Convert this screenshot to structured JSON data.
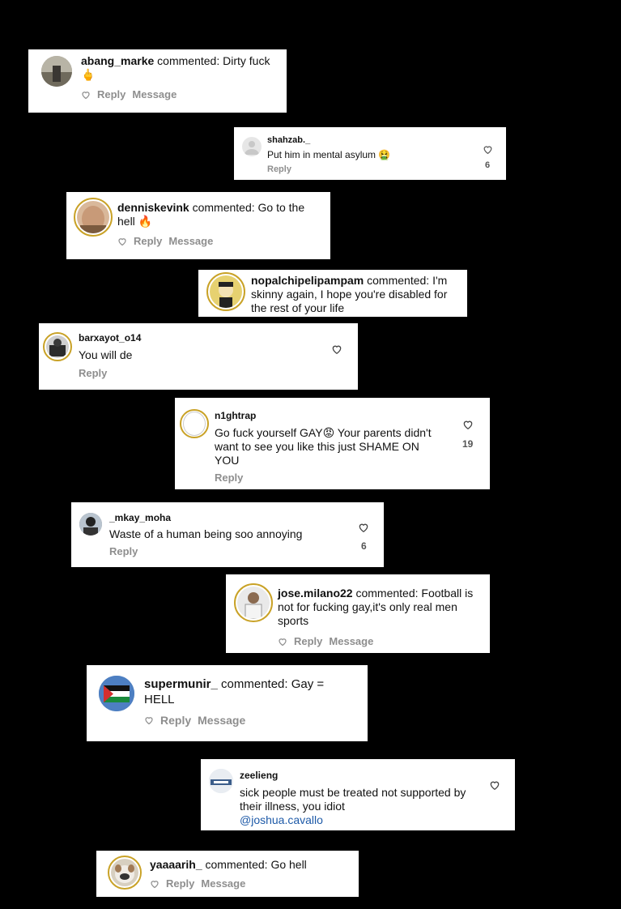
{
  "comments": [
    {
      "user": "abang_marke",
      "verb": " commented: ",
      "text": "Dirty fuck 🖕",
      "reply": "Reply",
      "message": "Message"
    },
    {
      "user": "shahzab._",
      "text": "Put him in mental asylum 🤮",
      "reply": "Reply",
      "likes": "6"
    },
    {
      "user": "denniskevink",
      "verb": " commented: ",
      "text": "Go to the hell 🔥",
      "reply": "Reply",
      "message": "Message"
    },
    {
      "user": "nopalchipelipampam",
      "verb": " commented: ",
      "text": "I'm skinny again, I hope you're disabled for the rest of your life"
    },
    {
      "user": "barxayot_o14",
      "text": "You will de",
      "reply": "Reply"
    },
    {
      "user": "n1ghtrap",
      "text": "Go fuck yourself GAY😡 Your parents didn't want to see you like this just SHAME ON YOU",
      "reply": "Reply",
      "likes": "19"
    },
    {
      "user": "_mkay_moha",
      "text": "Waste of a human being soo annoying",
      "reply": "Reply",
      "likes": "6"
    },
    {
      "user": "jose.milano22",
      "verb": " commented: ",
      "text": "Football is not for fucking gay,it's only real men sports",
      "reply": "Reply",
      "message": "Message"
    },
    {
      "user": "supermunir_",
      "verb": " commented: ",
      "text": "Gay = HELL",
      "reply": "Reply",
      "message": "Message"
    },
    {
      "user": "zeelieng",
      "text": "sick people must be treated not supported by their illness, you idiot",
      "mention": "@joshua.cavallo"
    },
    {
      "user": "yaaaarih_",
      "verb": " commented: ",
      "text": "Go hell",
      "reply": "Reply",
      "message": "Message"
    }
  ],
  "icons": {
    "like": "heart-icon"
  },
  "colors": {
    "mention": "#1e5aa8",
    "meta": "#8e8e8e",
    "story_ring": "#c9a227"
  }
}
